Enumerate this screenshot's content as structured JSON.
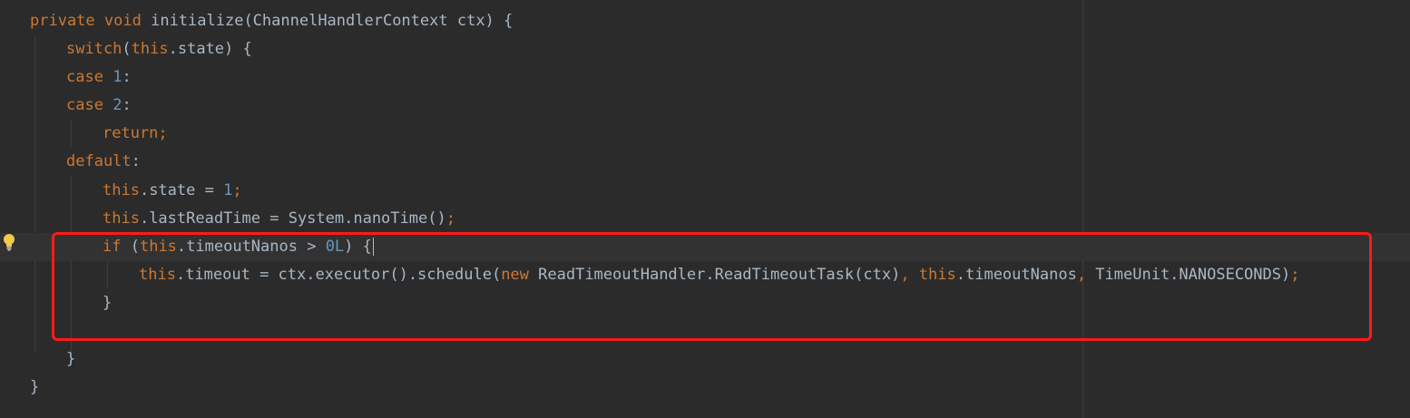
{
  "editor": {
    "lines": {
      "l1": [
        "private",
        " ",
        "void",
        " initialize(ChannelHandlerContext ctx) {"
      ],
      "l2": [
        "switch",
        "(",
        "this",
        ".state) {"
      ],
      "l3": [
        "case",
        " ",
        "1",
        ":"
      ],
      "l4": [
        "case",
        " ",
        "2",
        ":"
      ],
      "l5": [
        "return;"
      ],
      "l6": [
        "default",
        ":"
      ],
      "l7": [
        "this",
        ".state = ",
        "1",
        ";"
      ],
      "l8": [
        "this",
        ".lastReadTime = System.nanoTime()",
        ";"
      ],
      "l9": [
        "if",
        " (",
        "this",
        ".timeoutNanos > ",
        "0L",
        ") {"
      ],
      "l10": [
        "this",
        ".timeout = ctx.executor().schedule(",
        "new",
        " ReadTimeoutHandler.ReadTimeoutTask(ctx)",
        ", ",
        "this",
        ".timeoutNanos",
        ", ",
        "TimeUnit.NANOSECONDS)",
        ";"
      ],
      "l11": [
        "}"
      ],
      "l12": [
        ""
      ],
      "l13": [
        "}"
      ],
      "l14": [
        "}"
      ]
    },
    "gutter_icon": "lightbulb-icon",
    "annotation_color": "#ff1a1a"
  }
}
